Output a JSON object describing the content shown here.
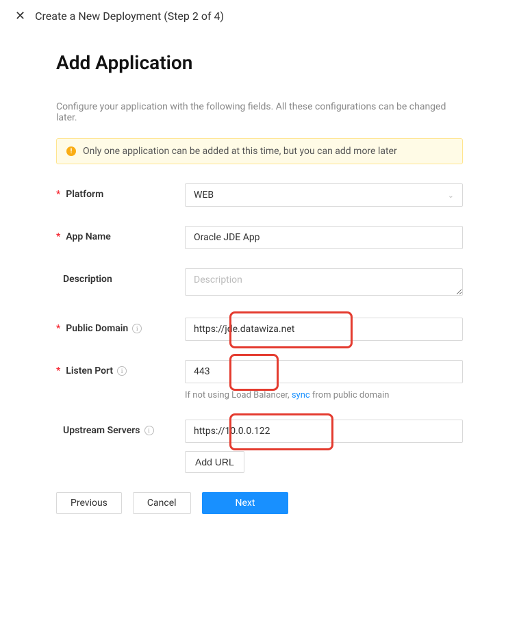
{
  "header": {
    "close": "✕",
    "title": "Create a New Deployment (Step 2 of 4)"
  },
  "page": {
    "title": "Add Application",
    "description": "Configure your application with the following fields. All these configurations can be changed later."
  },
  "alert": {
    "text": "Only one application can be added at this time, but you can add more later"
  },
  "form": {
    "platform": {
      "label": "Platform",
      "value": "WEB"
    },
    "app_name": {
      "label": "App Name",
      "value": "Oracle JDE App"
    },
    "description": {
      "label": "Description",
      "placeholder": "Description",
      "value": ""
    },
    "public_domain": {
      "label": "Public Domain",
      "value": "https://jde.datawiza.net"
    },
    "listen_port": {
      "label": "Listen Port",
      "value": "443",
      "hint_prefix": "If not using Load Balancer, ",
      "hint_link": "sync",
      "hint_suffix": " from public domain"
    },
    "upstream": {
      "label": "Upstream Servers",
      "value": "https://10.0.0.122",
      "add_url": "Add URL"
    }
  },
  "buttons": {
    "previous": "Previous",
    "cancel": "Cancel",
    "next": "Next"
  }
}
